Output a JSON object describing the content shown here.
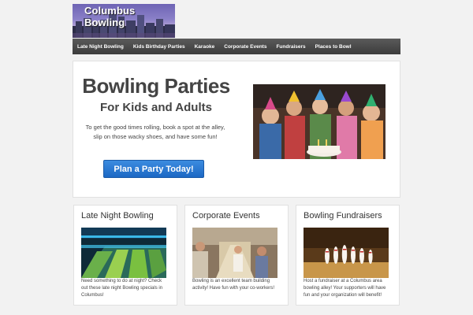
{
  "header": {
    "logo_text": "Columbus Bowling"
  },
  "nav": {
    "items": [
      "Late Night Bowling",
      "Kids Birthday Parties",
      "Karaoke",
      "Corporate Events",
      "Fundraisers",
      "Places to Bowl"
    ]
  },
  "hero": {
    "title": "Bowling Parties",
    "subtitle": "For Kids and Adults",
    "body": "To get the good times rolling, book a spot at the alley, slip on those wacky shoes, and have some fun!",
    "cta_label": "Plan a Party Today!"
  },
  "cards": [
    {
      "title": "Late Night Bowling",
      "text": "Need something to do at night? Check out these late night Bowling specials in Columbus!"
    },
    {
      "title": "Corporate Events",
      "text": "Bowling is an excellent team building activity! Have fun with your co-workers!"
    },
    {
      "title": "Bowling Fundraisers",
      "text": "Host a fundraiser at a Columbus area bowling alley! Your supporters will have fun and your organization will benefit!"
    }
  ],
  "colors": {
    "accent": "#1c68c4",
    "nav_bg": "#444444"
  }
}
